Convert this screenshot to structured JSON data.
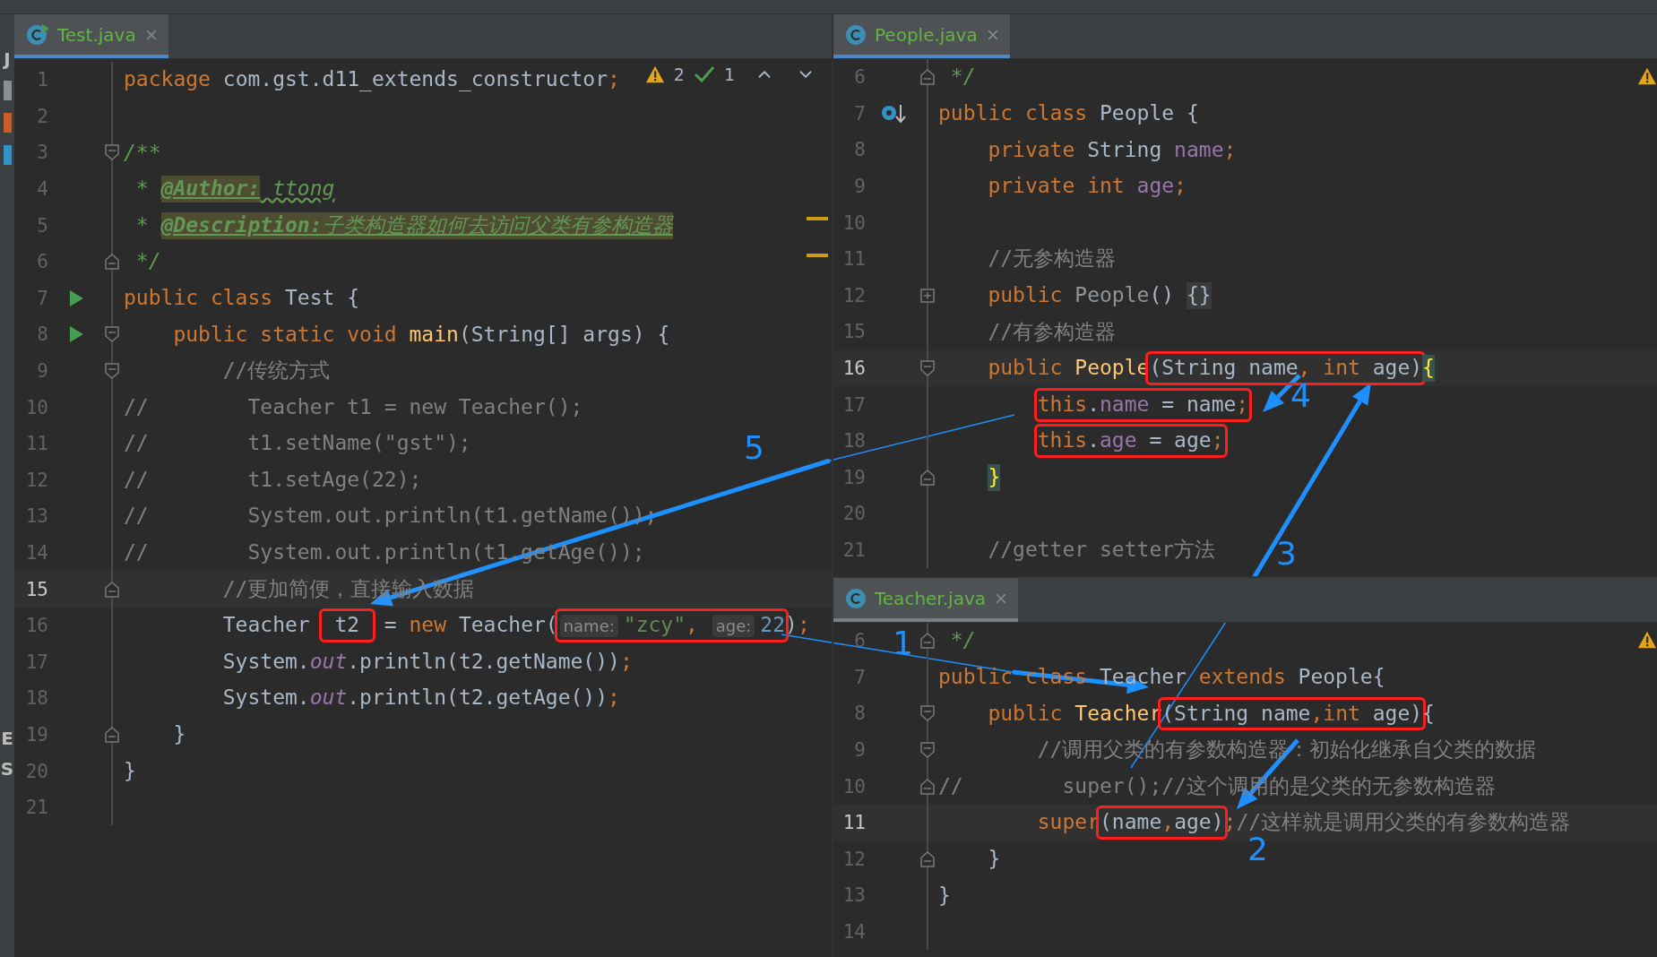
{
  "tool_strip": {
    "top_labels": [
      "J"
    ],
    "bottom_labels": [
      "E",
      "S"
    ]
  },
  "left_editor": {
    "tab": {
      "label": "Test.java",
      "selected": true
    },
    "inspections": {
      "warnings": "2",
      "checks": "1"
    },
    "lines": [
      {
        "number": "1",
        "current": false,
        "tokens": [
          {
            "kind": "keyword",
            "text": "package "
          },
          {
            "kind": "plain",
            "text": "com.gst.d11_extends_constructor"
          },
          {
            "kind": "keyword",
            "text": ";"
          }
        ]
      },
      {
        "number": "2",
        "current": false
      },
      {
        "number": "3",
        "current": false,
        "gutter": [
          {
            "kind": "fold-start"
          }
        ],
        "tokens": [
          {
            "kind": "doc",
            "text": "/**"
          }
        ]
      },
      {
        "number": "4",
        "current": false,
        "tokens": [
          {
            "kind": "doc",
            "text": " * "
          },
          {
            "kind": "doc-tag",
            "text": "@Author:"
          },
          {
            "kind": "doc-value",
            "text": " ttong"
          }
        ]
      },
      {
        "number": "5",
        "current": false,
        "tokens": [
          {
            "kind": "doc",
            "text": " * "
          },
          {
            "kind": "doc-tag",
            "text": "@Description:"
          },
          {
            "kind": "doc-highlight",
            "text": "子类构造器如何去访问父类有参构造器"
          }
        ]
      },
      {
        "number": "6",
        "current": false,
        "gutter": [
          {
            "kind": "fold-end"
          }
        ],
        "tokens": [
          {
            "kind": "doc",
            "text": " */"
          }
        ]
      },
      {
        "number": "7",
        "current": false,
        "gutter": [
          {
            "kind": "run"
          }
        ],
        "tokens": [
          {
            "kind": "keyword",
            "text": "public class "
          },
          {
            "kind": "plain",
            "text": "Test {"
          }
        ]
      },
      {
        "number": "8",
        "current": false,
        "gutter": [
          {
            "kind": "run"
          },
          {
            "kind": "fold-start"
          }
        ],
        "tokens": [
          {
            "kind": "keyword",
            "text": "    public static void "
          },
          {
            "kind": "declaration",
            "text": "main"
          },
          {
            "kind": "plain",
            "text": "(String[] args) {"
          }
        ]
      },
      {
        "number": "9",
        "current": false,
        "gutter": [
          {
            "kind": "fold-start"
          }
        ],
        "tokens": [
          {
            "kind": "comment",
            "text": "        //传统方式"
          }
        ]
      },
      {
        "number": "10",
        "current": false,
        "tokens": [
          {
            "kind": "comment",
            "text": "//        Teacher t1 = new Teacher();"
          }
        ]
      },
      {
        "number": "11",
        "current": false,
        "tokens": [
          {
            "kind": "comment",
            "text": "//        t1.setName(\"gst\");"
          }
        ]
      },
      {
        "number": "12",
        "current": false,
        "tokens": [
          {
            "kind": "comment",
            "text": "//        t1.setAge(22);"
          }
        ]
      },
      {
        "number": "13",
        "current": false,
        "tokens": [
          {
            "kind": "comment",
            "text": "//        System.out.println(t1.getName());"
          }
        ]
      },
      {
        "number": "14",
        "current": false,
        "tokens": [
          {
            "kind": "comment",
            "text": "//        System.out.println(t1.getAge());"
          }
        ]
      },
      {
        "number": "15",
        "current": true,
        "gutter": [
          {
            "kind": "fold-end"
          }
        ],
        "tokens": [
          {
            "kind": "comment",
            "text": "        //更加简便，直接输入数据"
          }
        ]
      },
      {
        "number": "16",
        "current": false,
        "tokens": [
          {
            "kind": "plain",
            "text": "        Teacher "
          },
          {
            "kind": "boxed",
            "tokens": [
              {
                "kind": "plain",
                "text": " t2 "
              }
            ]
          },
          {
            "kind": "plain",
            "text": " = "
          },
          {
            "kind": "keyword",
            "text": "new "
          },
          {
            "kind": "plain",
            "text": "Teacher("
          },
          {
            "kind": "boxed",
            "tokens": [
              {
                "kind": "hint",
                "text": "name:"
              },
              {
                "kind": "string",
                "text": "\"zcy\""
              },
              {
                "kind": "keyword",
                "text": ", "
              },
              {
                "kind": "hint",
                "text": "age:"
              },
              {
                "kind": "number",
                "text": "22"
              }
            ]
          },
          {
            "kind": "plain",
            "text": ")"
          },
          {
            "kind": "keyword",
            "text": ";"
          }
        ]
      },
      {
        "number": "17",
        "current": false,
        "tokens": [
          {
            "kind": "plain",
            "text": "        System."
          },
          {
            "kind": "static",
            "text": "out"
          },
          {
            "kind": "plain",
            "text": ".println(t2.getName())"
          },
          {
            "kind": "keyword",
            "text": ";"
          }
        ]
      },
      {
        "number": "18",
        "current": false,
        "tokens": [
          {
            "kind": "plain",
            "text": "        System."
          },
          {
            "kind": "static",
            "text": "out"
          },
          {
            "kind": "plain",
            "text": ".println(t2.getAge())"
          },
          {
            "kind": "keyword",
            "text": ";"
          }
        ]
      },
      {
        "number": "19",
        "current": false,
        "gutter": [
          {
            "kind": "fold-end"
          }
        ],
        "tokens": [
          {
            "kind": "plain",
            "text": "    }"
          }
        ]
      },
      {
        "number": "20",
        "current": false,
        "tokens": [
          {
            "kind": "plain",
            "text": "}"
          }
        ]
      },
      {
        "number": "21",
        "current": false
      }
    ]
  },
  "top_right_editor": {
    "tab": {
      "label": "People.java",
      "selected": true
    },
    "lines": [
      {
        "number": "6",
        "current": false,
        "gutter": [
          {
            "kind": "fold-end"
          }
        ],
        "tokens": [
          {
            "kind": "doc",
            "text": " */"
          }
        ]
      },
      {
        "number": "7",
        "current": false,
        "gutter": [
          {
            "kind": "override"
          }
        ],
        "tokens": [
          {
            "kind": "keyword",
            "text": "public class "
          },
          {
            "kind": "plain",
            "text": "People {"
          }
        ]
      },
      {
        "number": "8",
        "current": false,
        "tokens": [
          {
            "kind": "keyword",
            "text": "    private "
          },
          {
            "kind": "plain",
            "text": "String "
          },
          {
            "kind": "field",
            "text": "name"
          },
          {
            "kind": "keyword",
            "text": ";"
          }
        ]
      },
      {
        "number": "9",
        "current": false,
        "tokens": [
          {
            "kind": "keyword",
            "text": "    private int "
          },
          {
            "kind": "field",
            "text": "age"
          },
          {
            "kind": "keyword",
            "text": ";"
          }
        ]
      },
      {
        "number": "10",
        "current": false
      },
      {
        "number": "11",
        "current": false,
        "tokens": [
          {
            "kind": "comment",
            "text": "    //无参构造器"
          }
        ]
      },
      {
        "number": "12",
        "current": false,
        "gutter": [
          {
            "kind": "fold-plus"
          }
        ],
        "tokens": [
          {
            "kind": "keyword",
            "text": "    public "
          },
          {
            "kind": "unused",
            "text": "People"
          },
          {
            "kind": "plain",
            "text": "() "
          },
          {
            "kind": "folded",
            "text": "{}"
          }
        ]
      },
      {
        "number": "15",
        "current": false,
        "tokens": [
          {
            "kind": "comment",
            "text": "    //有参构造器"
          }
        ]
      },
      {
        "number": "16",
        "current": true,
        "gutter": [
          {
            "kind": "fold-start"
          }
        ],
        "tokens": [
          {
            "kind": "keyword",
            "text": "    public "
          },
          {
            "kind": "declaration",
            "text": "People"
          },
          {
            "kind": "boxed",
            "tokens": [
              {
                "kind": "plain",
                "text": "(String name"
              },
              {
                "kind": "keyword",
                "text": ", int "
              },
              {
                "kind": "plain",
                "text": "age)"
              }
            ]
          },
          {
            "kind": "brace",
            "text": "{"
          }
        ]
      },
      {
        "number": "17",
        "current": false,
        "tokens": [
          {
            "kind": "boxed",
            "indented": true,
            "tokens": [
              {
                "kind": "keyword",
                "text": "this"
              },
              {
                "kind": "plain",
                "text": "."
              },
              {
                "kind": "field",
                "text": "name"
              },
              {
                "kind": "plain",
                "text": " = name"
              },
              {
                "kind": "keyword",
                "text": ";"
              }
            ]
          }
        ]
      },
      {
        "number": "18",
        "current": false,
        "tokens": [
          {
            "kind": "boxed",
            "indented": true,
            "tokens": [
              {
                "kind": "keyword",
                "text": "this"
              },
              {
                "kind": "plain",
                "text": "."
              },
              {
                "kind": "field",
                "text": "age"
              },
              {
                "kind": "plain",
                "text": " = age"
              },
              {
                "kind": "keyword",
                "text": ";"
              }
            ]
          }
        ]
      },
      {
        "number": "19",
        "current": false,
        "gutter": [
          {
            "kind": "fold-end"
          }
        ],
        "tokens": [
          {
            "kind": "brace",
            "indented": true,
            "text": "}"
          }
        ]
      },
      {
        "number": "20",
        "current": false
      },
      {
        "number": "21",
        "current": false,
        "tokens": [
          {
            "kind": "comment",
            "text": "    //getter setter方法"
          }
        ]
      }
    ]
  },
  "bottom_right_editor": {
    "tab": {
      "label": "Teacher.java",
      "selected": false
    },
    "lines": [
      {
        "number": "6",
        "current": false,
        "gutter": [
          {
            "kind": "fold-end"
          }
        ],
        "tokens": [
          {
            "kind": "doc",
            "text": " */"
          }
        ]
      },
      {
        "number": "7",
        "current": false,
        "tokens": [
          {
            "kind": "keyword",
            "text": "public class "
          },
          {
            "kind": "plain",
            "text": "Teacher "
          },
          {
            "kind": "keyword",
            "text": "extends "
          },
          {
            "kind": "plain",
            "text": "People{"
          }
        ]
      },
      {
        "number": "8",
        "current": false,
        "gutter": [
          {
            "kind": "fold-start"
          }
        ],
        "tokens": [
          {
            "kind": "keyword",
            "text": "    public "
          },
          {
            "kind": "declaration",
            "text": "Teacher"
          },
          {
            "kind": "boxed",
            "tokens": [
              {
                "kind": "plain",
                "text": "(String name"
              },
              {
                "kind": "keyword",
                "text": ",int "
              },
              {
                "kind": "plain",
                "text": "age)"
              }
            ]
          },
          {
            "kind": "plain",
            "text": "{"
          }
        ]
      },
      {
        "number": "9",
        "current": false,
        "gutter": [
          {
            "kind": "fold-start"
          }
        ],
        "tokens": [
          {
            "kind": "comment",
            "text": "        //调用父类的有参数构造器：初始化继承自父类的数据"
          }
        ]
      },
      {
        "number": "10",
        "current": false,
        "gutter": [
          {
            "kind": "fold-end"
          }
        ],
        "tokens": [
          {
            "kind": "comment",
            "text": "//        super();//这个调用的是父类的无参数构造器"
          }
        ]
      },
      {
        "number": "11",
        "current": true,
        "tokens": [
          {
            "kind": "keyword",
            "text": "        super"
          },
          {
            "kind": "boxed",
            "tokens": [
              {
                "kind": "plain",
                "text": "(name"
              },
              {
                "kind": "keyword",
                "text": ","
              },
              {
                "kind": "plain",
                "text": "age)"
              }
            ]
          },
          {
            "kind": "keyword",
            "text": ";"
          },
          {
            "kind": "comment",
            "text": "//这样就是调用父类的有参数构造器"
          }
        ]
      },
      {
        "number": "12",
        "current": false,
        "gutter": [
          {
            "kind": "fold-end"
          }
        ],
        "tokens": [
          {
            "kind": "plain",
            "text": "    }"
          }
        ]
      },
      {
        "number": "13",
        "current": false,
        "tokens": [
          {
            "kind": "plain",
            "text": "}"
          }
        ]
      },
      {
        "number": "14",
        "current": false
      }
    ]
  },
  "annotations": [
    {
      "label": "5"
    },
    {
      "label": "1"
    },
    {
      "label": "3"
    },
    {
      "label": "4"
    },
    {
      "label": "2"
    }
  ]
}
